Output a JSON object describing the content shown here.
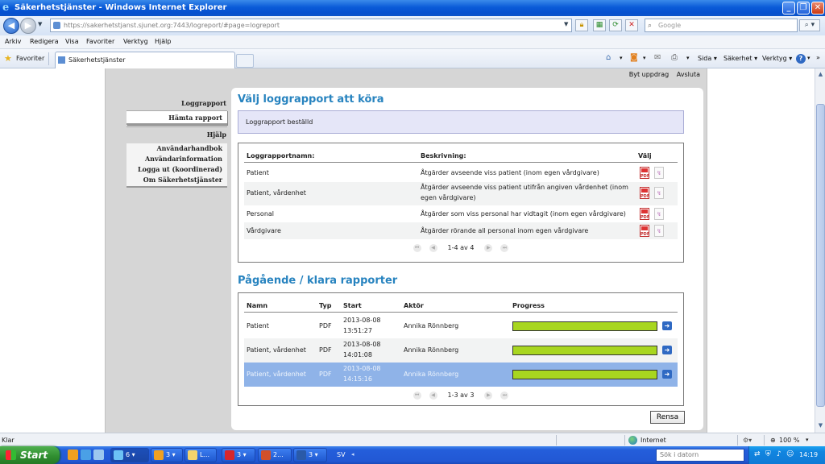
{
  "window": {
    "title": "Säkerhetstjänster - Windows Internet Explorer",
    "icon": "ie-icon"
  },
  "address_bar": {
    "url": "https://sakerhetstjanst.sjunet.org:7443/logreport/#page=logreport",
    "search_placeholder": "Google"
  },
  "menu": [
    "Arkiv",
    "Redigera",
    "Visa",
    "Favoriter",
    "Verktyg",
    "Hjälp"
  ],
  "favorites": {
    "label": "Favoriter",
    "tab_title": "Säkerhetstjänster"
  },
  "command_bar": {
    "page": "Sida",
    "safety": "Säkerhet",
    "tools": "Verktyg"
  },
  "toplinks": {
    "switch_assignment": "Byt uppdrag",
    "quit": "Avsluta"
  },
  "sidebar": {
    "logreport_heading": "Loggrapport",
    "fetch_report": "Hämta rapport",
    "help_heading": "Hjälp",
    "help_links": [
      "Användarhandbok",
      "Användarinformation",
      "Logga ut (koordinerad)",
      "Om Säkerhetstjänster"
    ]
  },
  "main": {
    "choose_title": "Välj loggrapport att köra",
    "notice": "Loggrapport beställd",
    "reports_table": {
      "headers": {
        "name": "Loggrapportnamn:",
        "description": "Beskrivning:",
        "select": "Välj"
      },
      "rows": [
        {
          "name": "Patient",
          "desc1": "Åtgärder avseende viss patient (inom egen vårdgivare)",
          "desc2": ""
        },
        {
          "name": "Patient, vårdenhet",
          "desc1": "Åtgärder avseende viss patient utifrån angiven vårdenhet (inom",
          "desc2": "egen vårdgivare)"
        },
        {
          "name": "Personal",
          "desc1": "Åtgärder som viss personal har vidtagit (inom egen vårdgivare)",
          "desc2": ""
        },
        {
          "name": "Vårdgivare",
          "desc1": "Åtgärder rörande all personal inom egen vårdgivare",
          "desc2": ""
        }
      ],
      "pager": "1-4 av 4"
    },
    "running_title": "Pågående / klara rapporter",
    "running_table": {
      "headers": {
        "name": "Namn",
        "type": "Typ",
        "start": "Start",
        "actor": "Aktör",
        "progress": "Progress"
      },
      "rows": [
        {
          "name": "Patient",
          "type": "PDF",
          "date": "2013-08-08",
          "time": "13:51:27",
          "actor": "Annika Rönnberg",
          "progress": 1.0
        },
        {
          "name": "Patient, vårdenhet",
          "type": "PDF",
          "date": "2013-08-08",
          "time": "14:01:08",
          "actor": "Annika Rönnberg",
          "progress": 1.0
        },
        {
          "name": "Patient, vårdenhet",
          "type": "PDF",
          "date": "2013-08-08",
          "time": "14:15:16",
          "actor": "Annika Rönnberg",
          "progress": 1.0
        }
      ],
      "pager": "1-3 av 3"
    },
    "clear_button": "Rensa",
    "progress_color": "#a8d620",
    "heading_color": "#2783bf"
  },
  "statusbar": {
    "status": "Klar",
    "zone": "Internet",
    "zoom": "100 %"
  },
  "taskbar": {
    "start": "Start",
    "tasks": [
      "6",
      "3",
      "L...",
      "3",
      "2...",
      "3"
    ],
    "language": "SV",
    "search_placeholder": "Sök i datorn",
    "clock": "14:19"
  }
}
